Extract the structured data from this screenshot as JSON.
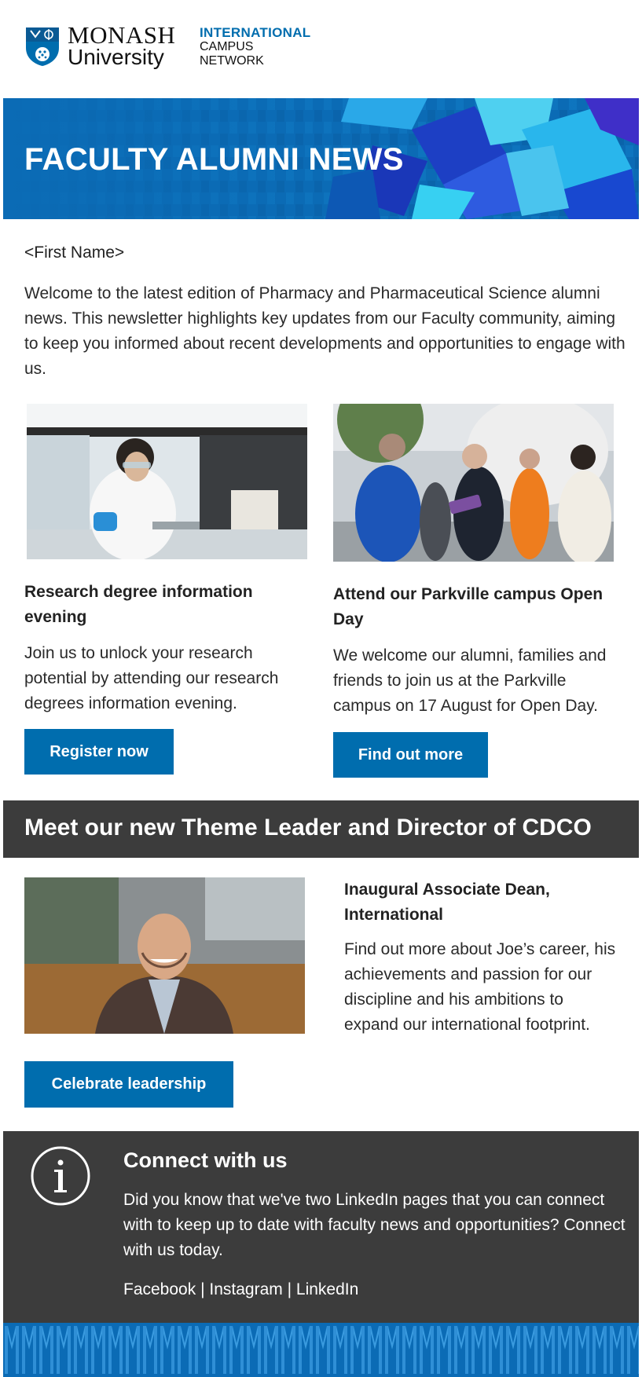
{
  "header": {
    "logo_line1": "MONASH",
    "logo_line2": "University",
    "network_line1": "INTERNATIONAL",
    "network_line2": "CAMPUS",
    "network_line3": "NETWORK"
  },
  "banner": {
    "title": "FACULTY ALUMNI NEWS"
  },
  "intro": {
    "greeting": "<First Name>",
    "text": "Welcome to the latest edition of Pharmacy and Pharmaceutical Science alumni news. This newsletter highlights key updates from our Faculty community, aiming to keep you informed about recent developments and opportunities to engage with us."
  },
  "cards": [
    {
      "title": "Research degree information evening",
      "body": "Join us to unlock your research potential by attending our research degrees information evening.",
      "button": "Register now"
    },
    {
      "title": "Attend our Parkville campus Open Day",
      "body": "We welcome our alumni, families and friends to join us at the Parkville campus on 17 August for Open Day.",
      "button": "Find out more"
    }
  ],
  "leader_section": {
    "heading": "Meet our new Theme Leader and Director of CDCO",
    "title": "Inaugural Associate Dean, International",
    "body": "Find out more about Joe’s career, his achievements and passion for our discipline and his ambitions to expand our international footprint.",
    "button": "Celebrate leadership"
  },
  "connect": {
    "title": "Connect with us",
    "body": "Did you know that we've two LinkedIn pages that you can connect with to keep up to date with faculty news and opportunities? Connect with us today.",
    "links": [
      "Facebook",
      "Instagram",
      "LinkedIn"
    ],
    "separator": "|"
  },
  "colors": {
    "brand_blue": "#006dae",
    "banner_blue": "#0b6bb5",
    "dark_panel": "#3c3c3c"
  }
}
